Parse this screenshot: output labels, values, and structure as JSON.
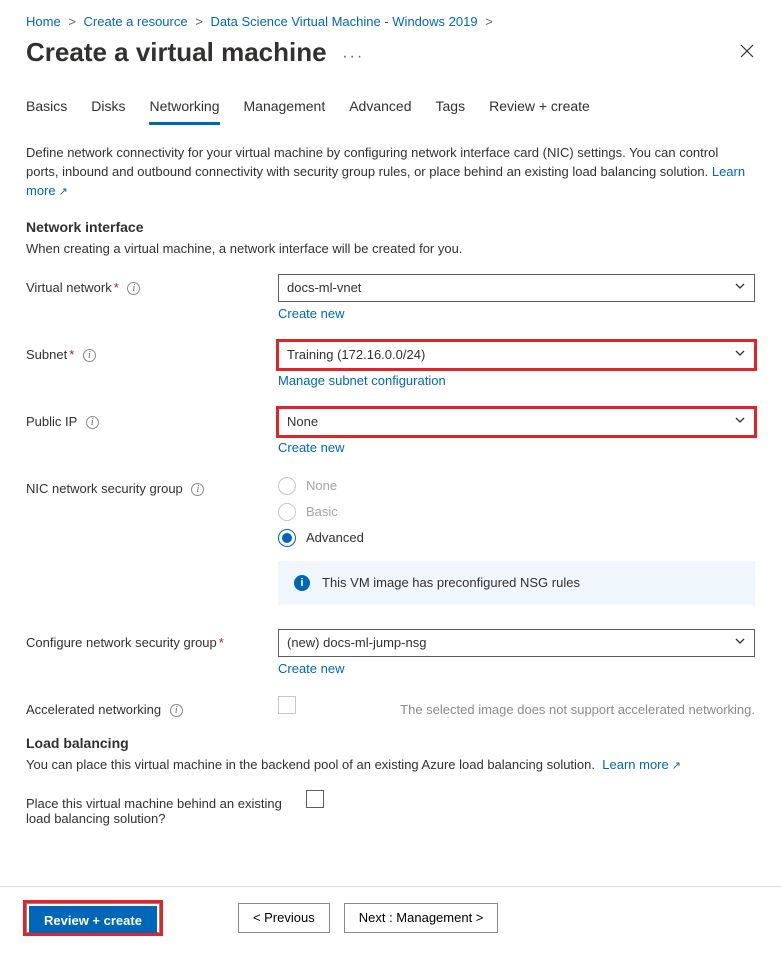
{
  "breadcrumb": [
    {
      "label": "Home"
    },
    {
      "label": "Create a resource"
    },
    {
      "label": "Data Science Virtual Machine - Windows 2019"
    }
  ],
  "title": "Create a virtual machine",
  "tabs": [
    {
      "label": "Basics",
      "active": false
    },
    {
      "label": "Disks",
      "active": false
    },
    {
      "label": "Networking",
      "active": true
    },
    {
      "label": "Management",
      "active": false
    },
    {
      "label": "Advanced",
      "active": false
    },
    {
      "label": "Tags",
      "active": false
    },
    {
      "label": "Review + create",
      "active": false
    }
  ],
  "intro": "Define network connectivity for your virtual machine by configuring network interface card (NIC) settings. You can control ports, inbound and outbound connectivity with security group rules, or place behind an existing load balancing solution.",
  "learn_more": "Learn more",
  "section_ni_title": "Network interface",
  "section_ni_sub": "When creating a virtual machine, a network interface will be created for you.",
  "fields": {
    "vnet_label": "Virtual network",
    "vnet_value": "docs-ml-vnet",
    "vnet_link": "Create new",
    "subnet_label": "Subnet",
    "subnet_value": "Training (172.16.0.0/24)",
    "subnet_link": "Manage subnet configuration",
    "pip_label": "Public IP",
    "pip_value": "None",
    "pip_link": "Create new",
    "nsg_label": "NIC network security group",
    "nsg_options": {
      "none": "None",
      "basic": "Basic",
      "advanced": "Advanced"
    },
    "nsg_info": "This VM image has preconfigured NSG rules",
    "cfg_nsg_label": "Configure network security group",
    "cfg_nsg_value": "(new) docs-ml-jump-nsg",
    "cfg_nsg_link": "Create new",
    "accel_label": "Accelerated networking",
    "accel_helper": "The selected image does not support accelerated networking."
  },
  "section_lb_title": "Load balancing",
  "section_lb_sub": "You can place this virtual machine in the backend pool of an existing Azure load balancing solution.",
  "lb_learn": "Learn more",
  "lb_field_label": "Place this virtual machine behind an existing load balancing solution?",
  "footer": {
    "review": "Review + create",
    "prev": "<  Previous",
    "next": "Next : Management  >"
  }
}
